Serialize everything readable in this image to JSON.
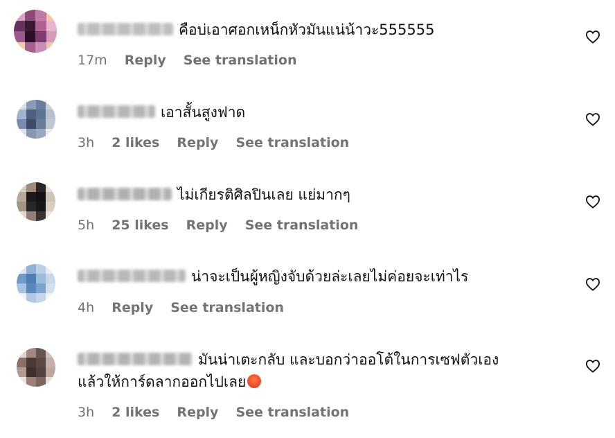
{
  "comments": [
    {
      "text": "คือบ่เอาศอกเหน็กหัวมันแน่น้าวะ555555",
      "time": "17m",
      "likes": "",
      "reply": "Reply",
      "see_translation": "See translation",
      "avatar_colors": [
        "#d9a3c0",
        "#8b4b78",
        "#c07aa8",
        "#f2c79a",
        "#6a3060",
        "#3b1a35",
        "#b25f92",
        "#e6b4d0",
        "#9c5a8c",
        "#2d0f28",
        "#7d3d6e",
        "#d49ab8",
        "#f0d0a0",
        "#a8608e",
        "#c98fb3",
        "#efc6a0"
      ],
      "username_color": "#bdbdbd",
      "heart_icon": "heart-outline-icon"
    },
    {
      "text": "เอาสั้นสูงฟาด",
      "time": "3h",
      "likes": "2 likes",
      "reply": "Reply",
      "see_translation": "See translation",
      "avatar_colors": [
        "#d8dde6",
        "#8c9bb5",
        "#6b7d9e",
        "#c9ced8",
        "#a3b2c9",
        "#4e5f80",
        "#5f7394",
        "#b7c0d0",
        "#7a8cad",
        "#3d4c6b",
        "#6a7d9c",
        "#c0c8d6",
        "#dfe3ea",
        "#8896b0",
        "#9aa8c2",
        "#e8ebf0"
      ],
      "username_color": "#b5b5b5",
      "heart_icon": "heart-outline-icon"
    },
    {
      "text": "ไม่เกียรติศิลปินเลย แย่มากๆ",
      "time": "5h",
      "likes": "25 likes",
      "reply": "Reply",
      "see_translation": "See translation",
      "avatar_colors": [
        "#d7cbc0",
        "#9c8c7e",
        "#2a2624",
        "#e6ddd3",
        "#b8a898",
        "#1d1a19",
        "#141212",
        "#cfc3b6",
        "#a39484",
        "#2b2725",
        "#181616",
        "#d9cfc4",
        "#e3dbd1",
        "#8f8073",
        "#3a3431",
        "#ebe4dc"
      ],
      "username_color": "#b0b0b0",
      "heart_icon": "heart-outline-icon"
    },
    {
      "text": "น่าจะเป็นผู้หญิงจับด้วยล่ะเลยไม่ค่อยจะเท่าไร",
      "time": "4h",
      "likes": "",
      "reply": "Reply",
      "see_translation": "See translation",
      "avatar_colors": [
        "#dfe6ee",
        "#8fb2d6",
        "#b9cfe6",
        "#e7edf3",
        "#6f9ac6",
        "#4d7fb5",
        "#9dbcdd",
        "#c8d8ea",
        "#a5c2df",
        "#5a88bb",
        "#7ca3cd",
        "#d3e0ee",
        "#eef2f6",
        "#b3c8de",
        "#c5d6e8",
        "#f2f5f8"
      ],
      "username_color": "#b8b8b8",
      "heart_icon": "heart-outline-icon"
    },
    {
      "text_line1": "มันน่าเตะกลับ และบอกว่าออโต้ในการเซฟตัวเอง",
      "text_line2": "แล้วให้การ์ดลากออกไปเลย",
      "time": "3h",
      "likes": "2 likes",
      "reply": "Reply",
      "see_translation": "See translation",
      "avatar_colors": [
        "#e2d6d0",
        "#a08a82",
        "#6a5650",
        "#d0c0b8",
        "#8a7068",
        "#4a3a36",
        "#5c4844",
        "#c4b0a8",
        "#b09a92",
        "#3e302c",
        "#524240",
        "#bca8a0",
        "#ece3de",
        "#9a8279",
        "#7c6660",
        "#e8ddd8"
      ],
      "username_color": "#b2b2b2",
      "heart_icon": "heart-outline-icon",
      "emoji": "angry-face-emoji"
    }
  ]
}
